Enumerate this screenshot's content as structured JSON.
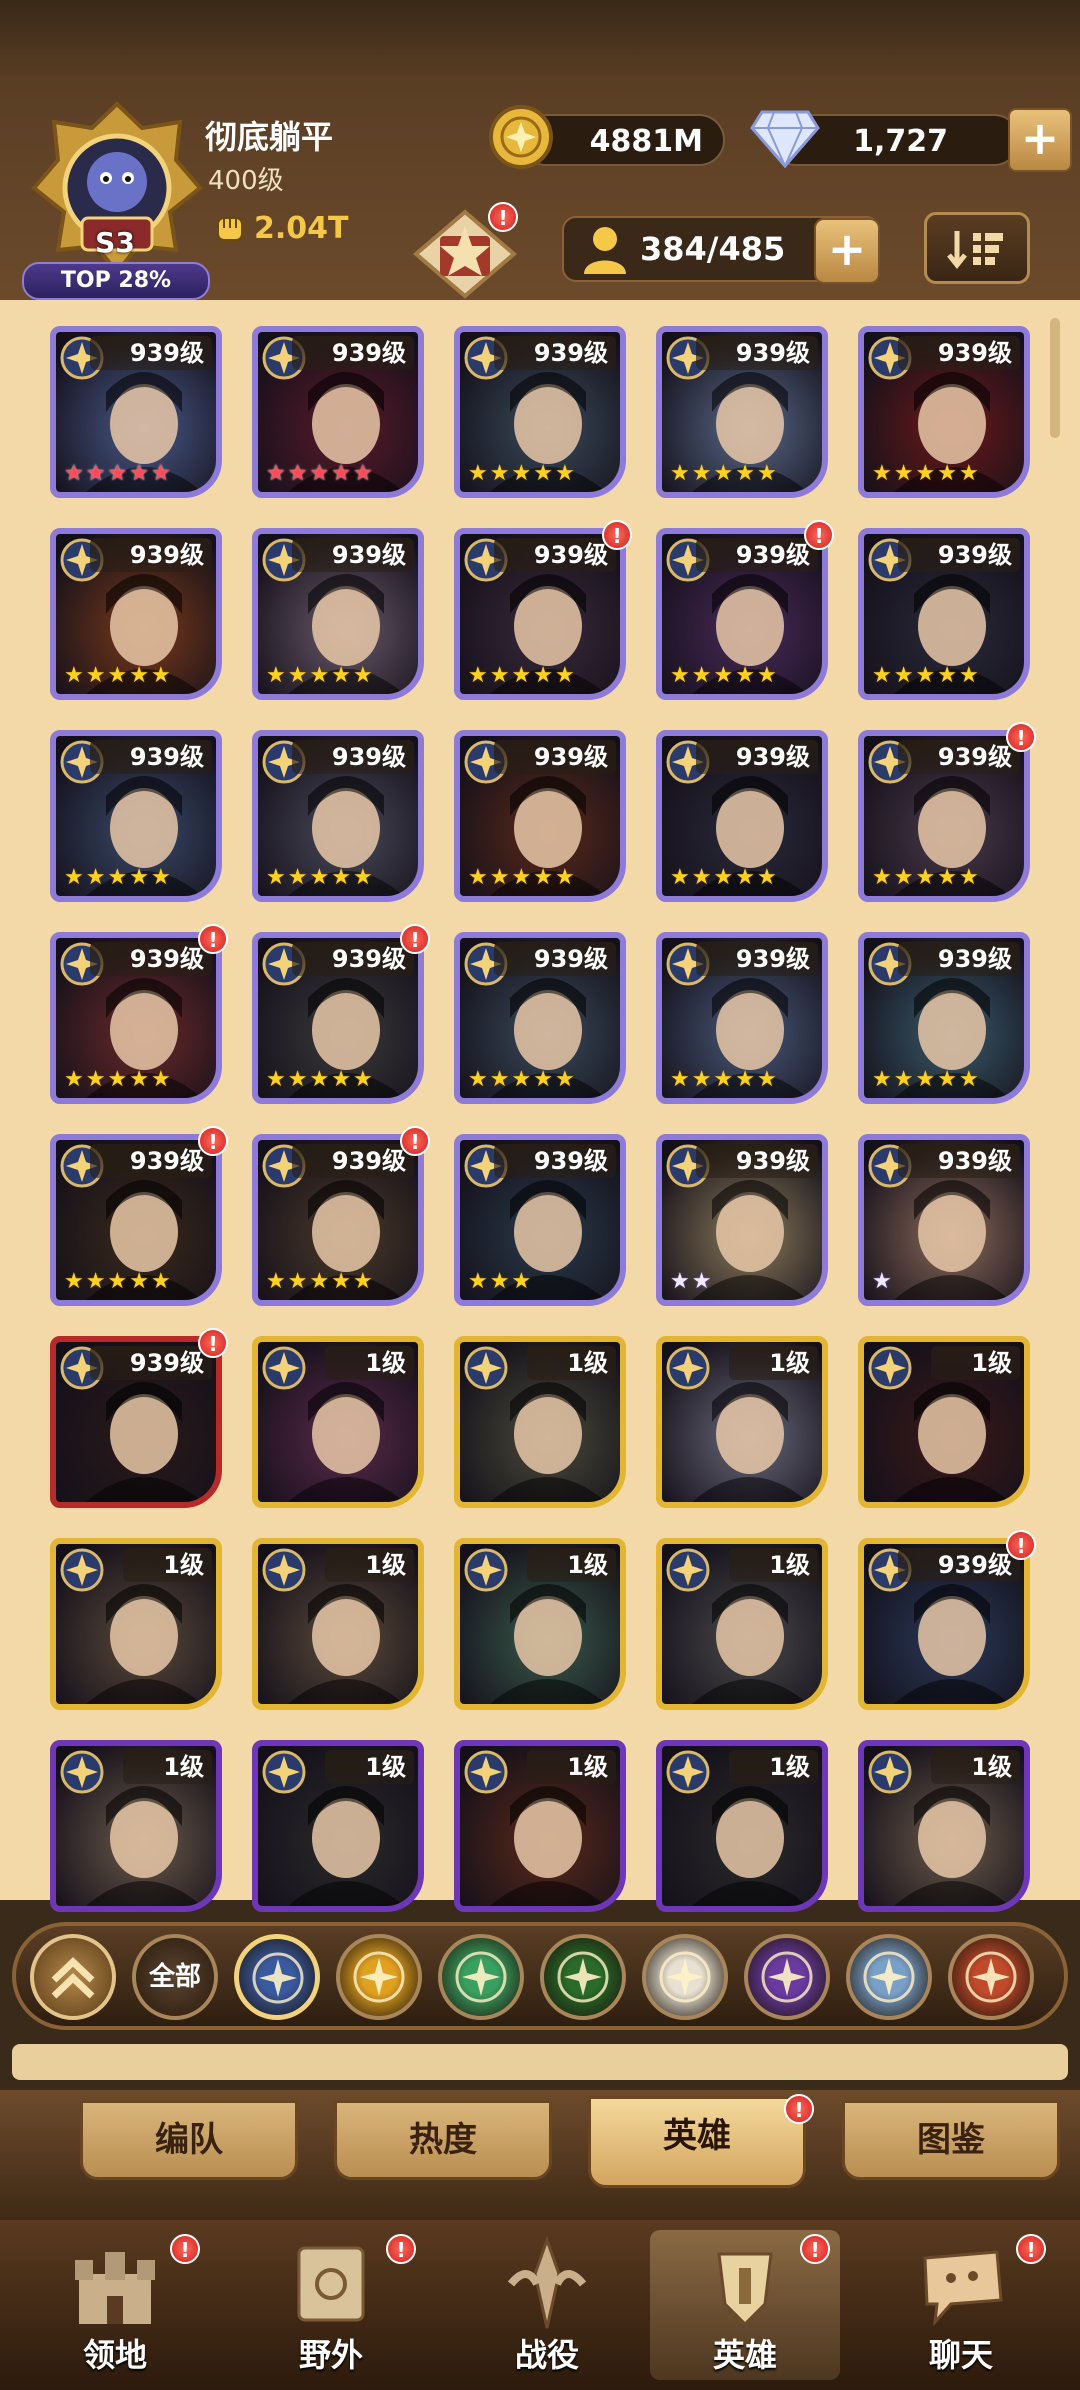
{
  "header": {
    "player_name": "彻底躺平",
    "player_level": "400级",
    "rank_badge": "S3",
    "top_percent": "TOP 28%",
    "power_value": "2.04T",
    "gold_amount": "4881M",
    "gem_amount": "1,727",
    "gem_plus_label": "+",
    "hero_count": "384/485",
    "hero_plus_label": "+",
    "sort_icon": "sort-icon"
  },
  "heroes": [
    {
      "level": "939级",
      "frame": "purple",
      "stars": 5,
      "star_color": "red",
      "alert": false,
      "portrait_color": "#4a5a8a"
    },
    {
      "level": "939级",
      "frame": "purple",
      "stars": 5,
      "star_color": "red",
      "alert": false,
      "portrait_color": "#5a1a2a"
    },
    {
      "level": "939级",
      "frame": "purple",
      "stars": 5,
      "star_color": "gold",
      "alert": false,
      "portrait_color": "#3a4a5a"
    },
    {
      "level": "939级",
      "frame": "purple",
      "stars": 5,
      "star_color": "gold",
      "alert": false,
      "portrait_color": "#5a6a8a"
    },
    {
      "level": "939级",
      "frame": "purple",
      "stars": 5,
      "star_color": "gold",
      "alert": false,
      "portrait_color": "#6a1a1a"
    },
    {
      "level": "939级",
      "frame": "purple",
      "stars": 5,
      "star_color": "gold",
      "alert": false,
      "portrait_color": "#7a3a1a"
    },
    {
      "level": "939级",
      "frame": "purple",
      "stars": 5,
      "star_color": "gold",
      "alert": false,
      "portrait_color": "#6a5a6a"
    },
    {
      "level": "939级",
      "frame": "purple",
      "stars": 5,
      "star_color": "gold",
      "alert": true,
      "portrait_color": "#3a2a3a"
    },
    {
      "level": "939级",
      "frame": "purple",
      "stars": 5,
      "star_color": "gold",
      "alert": true,
      "portrait_color": "#4a2a5a"
    },
    {
      "level": "939级",
      "frame": "purple",
      "stars": 5,
      "star_color": "gold",
      "alert": false,
      "portrait_color": "#2a2a3a"
    },
    {
      "level": "939级",
      "frame": "purple",
      "stars": 5,
      "star_color": "gold",
      "alert": false,
      "portrait_color": "#3a4a6a"
    },
    {
      "level": "939级",
      "frame": "purple",
      "stars": 5,
      "star_color": "gold",
      "alert": false,
      "portrait_color": "#4a4a5a"
    },
    {
      "level": "939级",
      "frame": "purple",
      "stars": 5,
      "star_color": "gold",
      "alert": false,
      "portrait_color": "#5a2a1a"
    },
    {
      "level": "939级",
      "frame": "purple",
      "stars": 5,
      "star_color": "gold",
      "alert": false,
      "portrait_color": "#2a2a3a"
    },
    {
      "level": "939级",
      "frame": "purple",
      "stars": 5,
      "star_color": "gold",
      "alert": true,
      "portrait_color": "#4a3a4a"
    },
    {
      "level": "939级",
      "frame": "purple",
      "stars": 5,
      "star_color": "gold",
      "alert": true,
      "portrait_color": "#6a2a2a"
    },
    {
      "level": "939级",
      "frame": "purple",
      "stars": 5,
      "star_color": "gold",
      "alert": true,
      "portrait_color": "#3a3a3a"
    },
    {
      "level": "939级",
      "frame": "purple",
      "stars": 5,
      "star_color": "gold",
      "alert": false,
      "portrait_color": "#3a4a5a"
    },
    {
      "level": "939级",
      "frame": "purple",
      "stars": 5,
      "star_color": "gold",
      "alert": false,
      "portrait_color": "#4a5a7a"
    },
    {
      "level": "939级",
      "frame": "purple",
      "stars": 5,
      "star_color": "gold",
      "alert": false,
      "portrait_color": "#3a5a6a"
    },
    {
      "level": "939级",
      "frame": "purple",
      "stars": 5,
      "star_color": "gold",
      "alert": true,
      "portrait_color": "#3a2a1a"
    },
    {
      "level": "939级",
      "frame": "purple",
      "stars": 5,
      "star_color": "gold",
      "alert": true,
      "portrait_color": "#4a3a2a"
    },
    {
      "level": "939级",
      "frame": "purple",
      "stars": 3,
      "star_color": "gold",
      "alert": false,
      "portrait_color": "#2a3a4a"
    },
    {
      "level": "939级",
      "frame": "purple",
      "stars": 2,
      "star_color": "white",
      "alert": false,
      "portrait_color": "#8a7a5a"
    },
    {
      "level": "939级",
      "frame": "purple",
      "stars": 1,
      "star_color": "white",
      "alert": false,
      "portrait_color": "#8a6a5a"
    },
    {
      "level": "939级",
      "frame": "red",
      "stars": 0,
      "star_color": "gold",
      "alert": true,
      "portrait_color": "#2a1a1a"
    },
    {
      "level": "1级",
      "frame": "gold",
      "stars": 0,
      "star_color": "gold",
      "alert": false,
      "portrait_color": "#5a2a4a"
    },
    {
      "level": "1级",
      "frame": "gold",
      "stars": 0,
      "star_color": "gold",
      "alert": false,
      "portrait_color": "#4a4a3a"
    },
    {
      "level": "1级",
      "frame": "gold",
      "stars": 0,
      "star_color": "gold",
      "alert": false,
      "portrait_color": "#6a6a7a"
    },
    {
      "level": "1级",
      "frame": "gold",
      "stars": 0,
      "star_color": "gold",
      "alert": false,
      "portrait_color": "#3a1a1a"
    },
    {
      "level": "1级",
      "frame": "gold",
      "stars": 0,
      "star_color": "gold",
      "alert": false,
      "portrait_color": "#5a4a3a"
    },
    {
      "level": "1级",
      "frame": "gold",
      "stars": 0,
      "star_color": "gold",
      "alert": false,
      "portrait_color": "#5a4a3a"
    },
    {
      "level": "1级",
      "frame": "gold",
      "stars": 0,
      "star_color": "gold",
      "alert": false,
      "portrait_color": "#3a5a4a"
    },
    {
      "level": "1级",
      "frame": "gold",
      "stars": 0,
      "star_color": "gold",
      "alert": false,
      "portrait_color": "#4a4a4a"
    },
    {
      "level": "939级",
      "frame": "gold",
      "stars": 0,
      "star_color": "gold",
      "alert": true,
      "portrait_color": "#2a3a5a"
    },
    {
      "level": "1级",
      "frame": "violet",
      "stars": 0,
      "star_color": "gold",
      "alert": false,
      "portrait_color": "#6a5a4a"
    },
    {
      "level": "1级",
      "frame": "violet",
      "stars": 0,
      "star_color": "gold",
      "alert": false,
      "portrait_color": "#2a2a2a"
    },
    {
      "level": "1级",
      "frame": "violet",
      "stars": 0,
      "star_color": "gold",
      "alert": false,
      "portrait_color": "#5a2a1a"
    },
    {
      "level": "1级",
      "frame": "violet",
      "stars": 0,
      "star_color": "gold",
      "alert": false,
      "portrait_color": "#2a2a2a"
    },
    {
      "level": "1级",
      "frame": "violet",
      "stars": 0,
      "star_color": "gold",
      "alert": false,
      "portrait_color": "#6a5a4a"
    }
  ],
  "filters": {
    "collapse_icon": "chevron-up-icon",
    "all_label": "全部",
    "factions": [
      {
        "name": "lightbearer-icon",
        "color": "#3a5aa0"
      },
      {
        "name": "mauler-icon",
        "color": "#e0a020"
      },
      {
        "name": "wilder-icon",
        "color": "#3aa060"
      },
      {
        "name": "graveborn-icon",
        "color": "#2a6a2a"
      },
      {
        "name": "celestial-icon",
        "color": "#e8e0d0"
      },
      {
        "name": "hypogean-icon",
        "color": "#6a3aa0"
      },
      {
        "name": "dimensional-icon",
        "color": "#7aa0c8"
      },
      {
        "name": "fire-icon",
        "color": "#c04a2a"
      }
    ]
  },
  "sub_tabs": [
    {
      "label": "编队",
      "active": false,
      "alert": false
    },
    {
      "label": "热度",
      "active": false,
      "alert": false
    },
    {
      "label": "英雄",
      "active": true,
      "alert": true
    },
    {
      "label": "图鉴",
      "active": false,
      "alert": false
    }
  ],
  "bottom_nav": [
    {
      "label": "领地",
      "icon": "castle-icon",
      "active": false,
      "alert": true
    },
    {
      "label": "野外",
      "icon": "map-icon",
      "active": false,
      "alert": true
    },
    {
      "label": "战役",
      "icon": "battle-icon",
      "active": false,
      "alert": false
    },
    {
      "label": "英雄",
      "icon": "hero-icon",
      "active": true,
      "alert": true
    },
    {
      "label": "聊天",
      "icon": "chat-icon",
      "active": false,
      "alert": true
    }
  ],
  "alert_mark": "!"
}
